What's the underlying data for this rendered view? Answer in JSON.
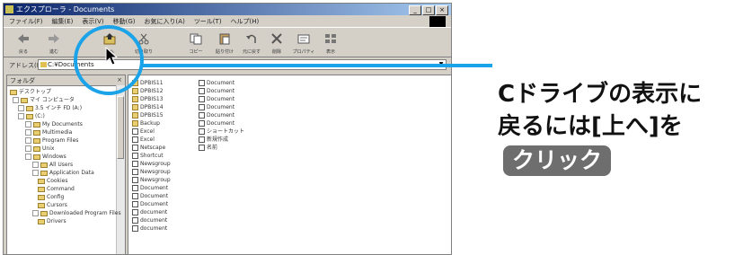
{
  "window": {
    "title": "エクスプローラ - Documents",
    "controls": [
      "_",
      "□",
      "×"
    ],
    "menu": [
      "ファイル(F)",
      "編集(E)",
      "表示(V)",
      "移動(G)",
      "お気に入り(A)",
      "ツール(T)",
      "ヘルプ(H)"
    ],
    "toolbar": [
      {
        "label": "戻る",
        "icon": "back-arrow-icon"
      },
      {
        "label": "進む",
        "icon": "forward-arrow-icon"
      },
      {
        "label": "上へ",
        "icon": "up-folder-icon"
      },
      {
        "label": "切り取り",
        "icon": "cut-icon"
      },
      {
        "label": "コピー",
        "icon": "copy-icon"
      },
      {
        "label": "貼り付け",
        "icon": "paste-icon"
      },
      {
        "label": "元に戻す",
        "icon": "undo-icon"
      },
      {
        "label": "削除",
        "icon": "delete-icon"
      },
      {
        "label": "プロパティ",
        "icon": "properties-icon"
      },
      {
        "label": "表示",
        "icon": "views-icon"
      }
    ],
    "address_label": "アドレス(D)",
    "address_value": "C:¥Documents",
    "tree_header": "フォルダ",
    "tree_close": "×",
    "tree": [
      "デスクトップ",
      "マイ コンピュータ",
      "3.5 インチ FD (A:)",
      "(C:)",
      "My Documents",
      "Multimedia",
      "Program Files",
      "Unix",
      "Windows",
      "All Users",
      "Application Data",
      "Cookies",
      "Command",
      "Config",
      "Cursors",
      "Downloaded Program Files",
      "Drivers"
    ],
    "files_col1": [
      "DPBIS11",
      "DPBIS12",
      "DPBIS13",
      "DPBIS14",
      "DPBIS15",
      "Backup",
      "Excel",
      "Excel",
      "Netscape",
      "Shortcut",
      "Newsgroup",
      "Newsgroup",
      "Newsgroup",
      "Document",
      "Document",
      "Document",
      "document",
      "document",
      "document"
    ],
    "files_col2": [
      "Document",
      "Document",
      "Document",
      "Document",
      "Document",
      "Document",
      "ショートカット",
      "新規作成",
      "名前"
    ]
  },
  "annotation": {
    "line1": "Cドライブの表示に",
    "line2": "戻るには[上へ]を",
    "badge": "クリック"
  },
  "colors": {
    "accent": "#1aa3e8",
    "badge_bg": "#6e6e6e",
    "titlebar": "#0a246a"
  }
}
